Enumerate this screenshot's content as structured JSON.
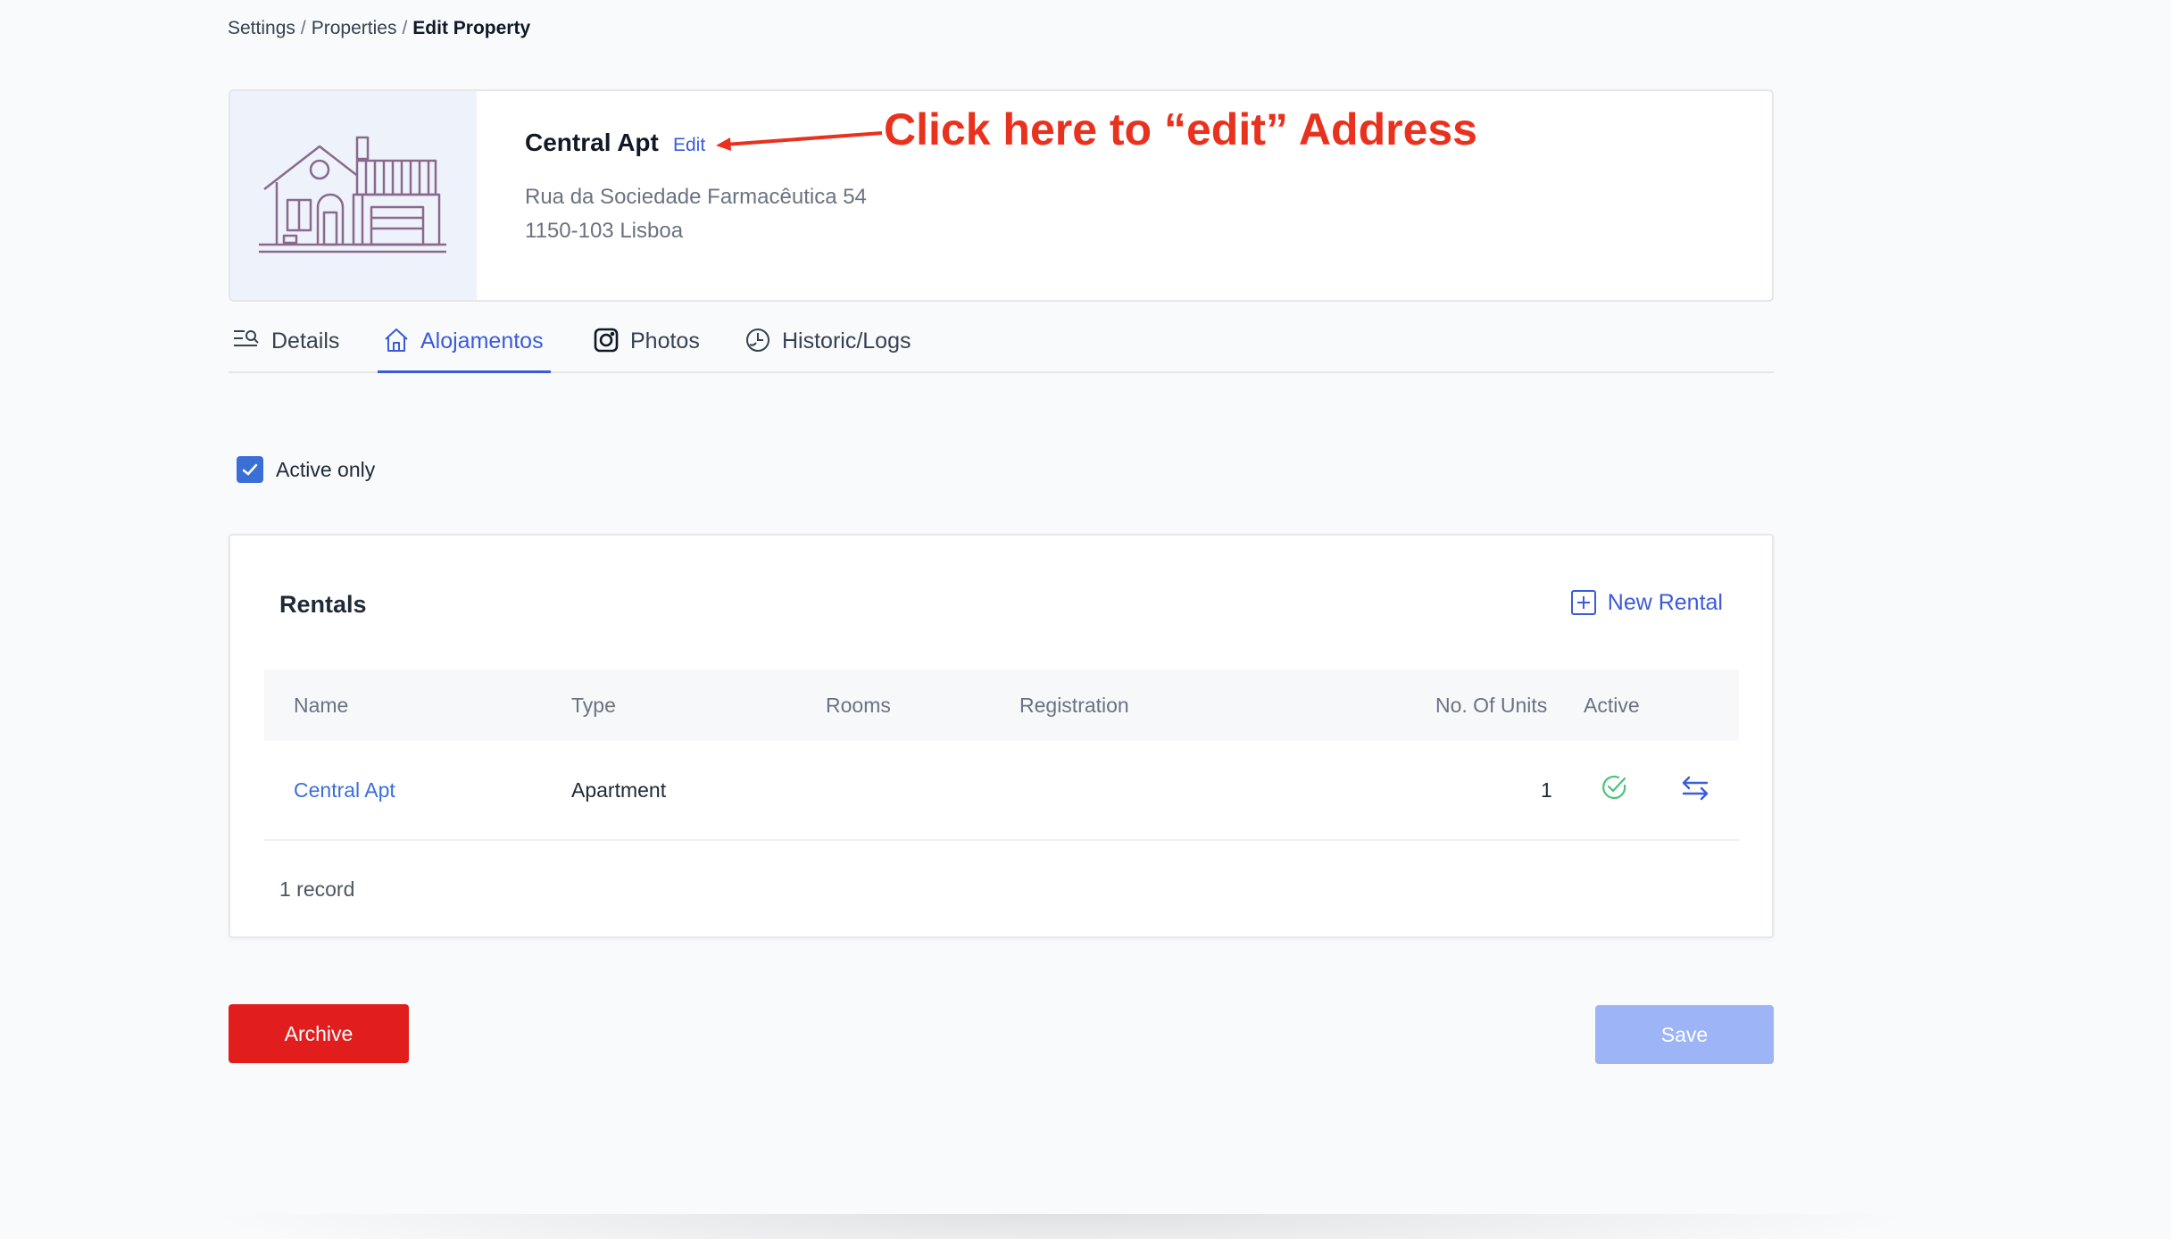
{
  "breadcrumb": {
    "items": [
      "Settings",
      "Properties"
    ],
    "separator": "/",
    "current": "Edit Property"
  },
  "property": {
    "name": "Central Apt",
    "edit_label": "Edit",
    "address_line1": "Rua da Sociedade Farmacêutica 54",
    "address_line2": "1150-103 Lisboa",
    "image_icon": "house-illustration"
  },
  "annotation": {
    "text": "Click here to “edit” Address",
    "color": "#e8321e"
  },
  "tabs": [
    {
      "label": "Details",
      "icon": "details-icon",
      "active": false
    },
    {
      "label": "Alojamentos",
      "icon": "home-icon",
      "active": true
    },
    {
      "label": "Photos",
      "icon": "camera-icon",
      "active": false
    },
    {
      "label": "Historic/Logs",
      "icon": "history-icon",
      "active": false
    }
  ],
  "filter": {
    "active_only_label": "Active only",
    "active_only_checked": true
  },
  "rentals": {
    "title": "Rentals",
    "new_rental_label": "New Rental",
    "columns": [
      "Name",
      "Type",
      "Rooms",
      "Registration",
      "No. Of Units",
      "Active"
    ],
    "rows": [
      {
        "name": "Central Apt",
        "type": "Apartment",
        "rooms": "",
        "registration": "",
        "units": "1",
        "active": true
      }
    ],
    "record_count": "1 record"
  },
  "actions": {
    "archive_label": "Archive",
    "save_label": "Save"
  },
  "colors": {
    "accent": "#3b5bdb",
    "danger": "#e11d1d",
    "save_disabled": "#9db5f7",
    "success": "#4cc27a"
  }
}
